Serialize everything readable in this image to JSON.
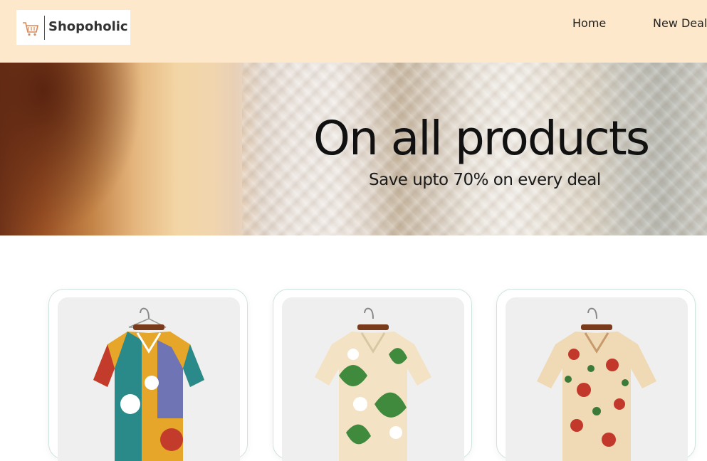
{
  "header": {
    "logo_text": "Shopoholic",
    "logo_icon": "cart-icon",
    "nav": [
      {
        "label": "Home"
      },
      {
        "label": "New Deals"
      }
    ]
  },
  "hero": {
    "title": "On all products",
    "subtitle": "Save upto 70% on every deal"
  },
  "products": [
    {
      "image_icon": "shirt-colorful-abstract-print",
      "colors": [
        "#e6a62a",
        "#2a8a8a",
        "#6f74b5",
        "#c23b2b"
      ]
    },
    {
      "image_icon": "shirt-floral-green-leaves",
      "colors": [
        "#f3e3c4",
        "#3f8a3c",
        "#ffffff"
      ]
    },
    {
      "image_icon": "shirt-floral-red-roses",
      "colors": [
        "#f0d9b5",
        "#c2392b",
        "#3c7a3a"
      ]
    }
  ]
}
